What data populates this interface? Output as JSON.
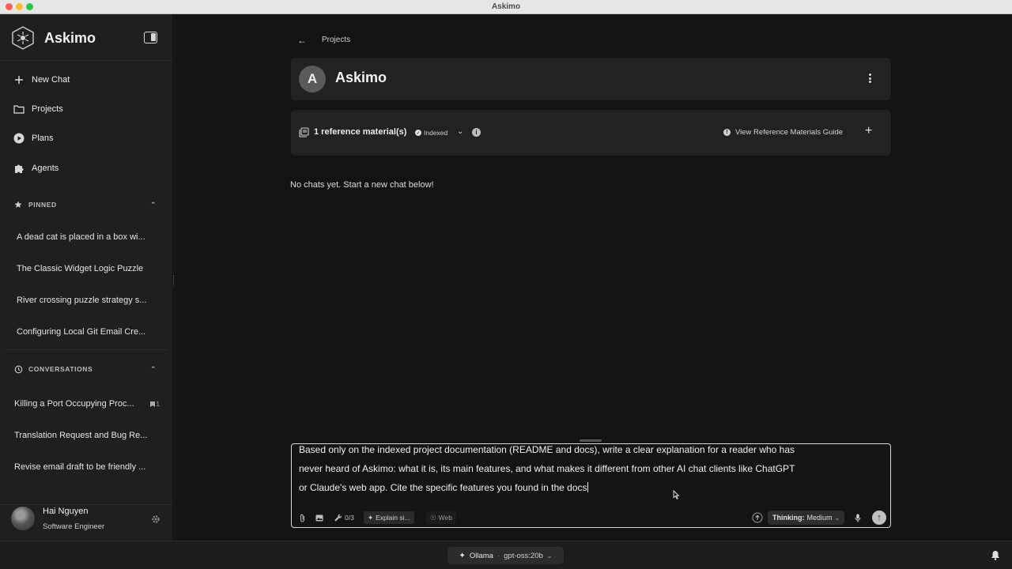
{
  "window": {
    "title": "Askimo"
  },
  "sidebar": {
    "brand": "Askimo",
    "nav": [
      {
        "label": "New Chat",
        "icon": "plus-icon"
      },
      {
        "label": "Projects",
        "icon": "folder-icon"
      },
      {
        "label": "Plans",
        "icon": "play-circle-icon"
      },
      {
        "label": "Agents",
        "icon": "puzzle-icon"
      }
    ],
    "pinned": {
      "heading": "PINNED",
      "items": [
        "A dead cat is placed in a box wi...",
        "The Classic Widget Logic Puzzle",
        "River crossing puzzle strategy s...",
        "Configuring Local Git Email Cre..."
      ]
    },
    "conversations": {
      "heading": "CONVERSATIONS",
      "items": [
        {
          "title": "Killing a Port Occupying Proc...",
          "count": "1"
        },
        {
          "title": "Translation Request and Bug Re...",
          "count": ""
        },
        {
          "title": "Revise email draft to be friendly ...",
          "count": ""
        }
      ]
    },
    "user": {
      "name": "Hai Nguyen",
      "role": "Software Engineer"
    }
  },
  "main": {
    "breadcrumb": "Projects",
    "project": {
      "initial": "A",
      "name": "Askimo"
    },
    "references": {
      "label": "1 reference material(s)",
      "status": "Indexed",
      "guide": "View Reference Materials Guide"
    },
    "empty_message": "No chats yet. Start a new chat below!"
  },
  "composer": {
    "lines": [
      "Based only on the indexed project documentation (README and docs), write a clear explanation for a reader who has",
      "never heard of Askimo: what it is, its main features, and what makes it different from other AI chat clients like ChatGPT",
      "or Claude's web app. Cite the specific features you found in the docs"
    ],
    "tools_count": "0/3",
    "mode_chip": "Explain si...",
    "web_chip": "Web",
    "thinking_label": "Thinking:",
    "thinking_value": "Medium"
  },
  "statusbar": {
    "provider": "Ollama",
    "separator": "·",
    "model": "gpt-oss:20b"
  }
}
